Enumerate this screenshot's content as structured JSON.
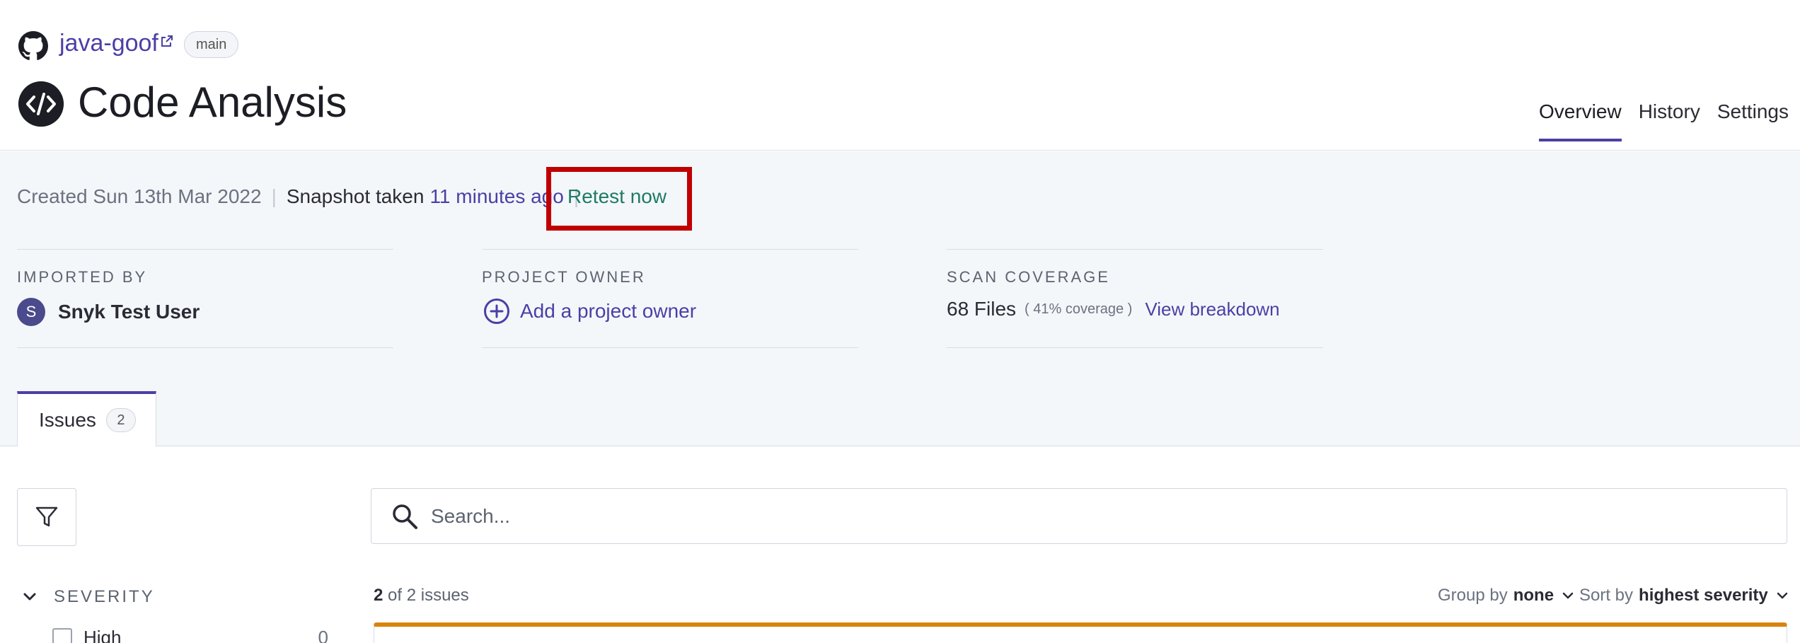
{
  "header": {
    "repo_name": "java-goof",
    "branch": "main",
    "title": "Code Analysis",
    "nav": [
      {
        "label": "Overview",
        "active": true
      },
      {
        "label": "History",
        "active": false
      },
      {
        "label": "Settings",
        "active": false
      }
    ]
  },
  "meta": {
    "created": "Created Sun 13th Mar 2022",
    "separator": "|",
    "snapshot_label": "Snapshot taken",
    "snapshot_ago": "11 minutes ago",
    "retest_label": "Retest now"
  },
  "info": {
    "imported_by": {
      "label": "IMPORTED BY",
      "avatar_initial": "S",
      "user": "Snyk Test User"
    },
    "project_owner": {
      "label": "PROJECT OWNER",
      "action": "Add a project owner"
    },
    "scan_coverage": {
      "label": "SCAN COVERAGE",
      "files": "68 Files",
      "coverage": "( 41% coverage )",
      "link": "View breakdown"
    }
  },
  "tabs": {
    "issues_label": "Issues",
    "issues_count": "2"
  },
  "search": {
    "placeholder": "Search..."
  },
  "filters": {
    "severity_label": "SEVERITY",
    "rows": [
      {
        "name": "High",
        "count": "0"
      }
    ]
  },
  "results": {
    "shown": "2",
    "text": "of 2 issues",
    "group_label": "Group by",
    "group_value": "none",
    "sort_label": "Sort by",
    "sort_value": "highest severity"
  },
  "colors": {
    "accent": "#4b3fa6",
    "retest": "#1e7b64",
    "highlight_box": "#c00000",
    "severity_bar": "#d8830f"
  },
  "icons": [
    "github-icon",
    "external-link-icon",
    "code-icon",
    "plus-circle-icon",
    "filter-icon",
    "search-icon",
    "chevron-down-icon"
  ]
}
